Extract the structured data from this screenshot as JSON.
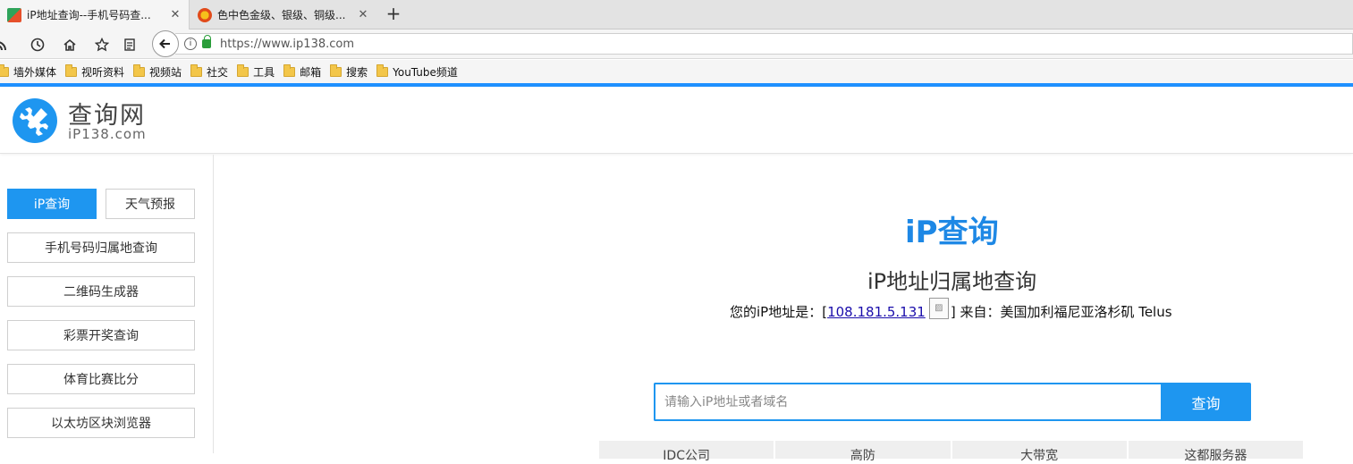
{
  "browser": {
    "tabs": [
      {
        "title": "iP地址查询--手机号码查...",
        "active": true
      },
      {
        "title": "色中色金级、银级、铜级...",
        "active": false
      }
    ],
    "url": "https://www.ip138.com",
    "bookmarks": [
      "墙外媒体",
      "视听资料",
      "视频站",
      "社交",
      "工具",
      "邮箱",
      "搜索",
      "YouTube频道"
    ]
  },
  "site": {
    "logo_title": "查询网",
    "logo_sub": "iP138.com"
  },
  "sidebar": {
    "items": [
      "iP查询",
      "天气预报",
      "手机号码归属地查询",
      "二维码生成器",
      "彩票开奖查询",
      "体育比赛比分",
      "以太坊区块浏览器"
    ]
  },
  "main": {
    "title": "iP查询",
    "subtitle": "iP地址归属地查询",
    "ip_prefix": "您的iP地址是：[",
    "ip_address": "108.181.5.131",
    "ip_suffix": "] 来自：美国加利福尼亚洛杉矶 Telus",
    "search_placeholder": "请输入iP地址或者域名",
    "search_button": "查询",
    "table_headers": [
      "IDC公司",
      "高防",
      "大带宽",
      "这都服务器"
    ]
  },
  "colors": {
    "accent": "#1e96f0",
    "title_blue": "#1e88e5"
  }
}
